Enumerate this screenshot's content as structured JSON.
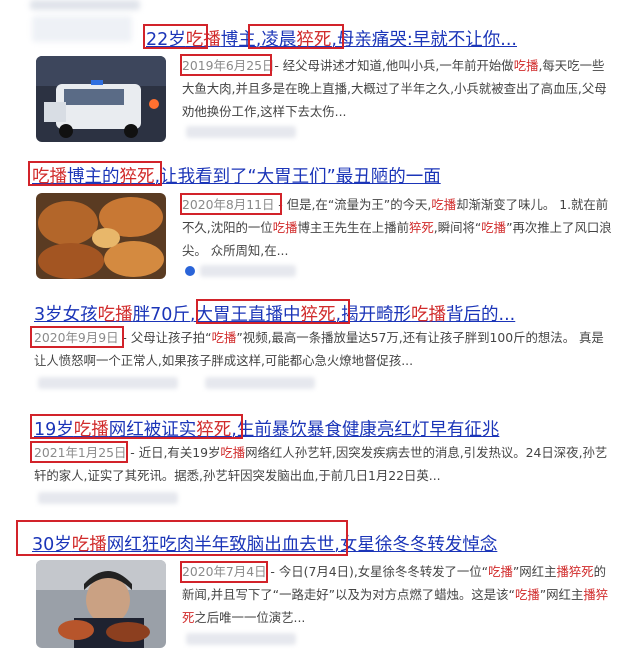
{
  "results": [
    {
      "title_parts": [
        {
          "t": "22岁",
          "hl": false
        },
        {
          "t": "吃播",
          "hl": true
        },
        {
          "t": "博主,凌晨",
          "hl": false
        },
        {
          "t": "猝死",
          "hl": true
        },
        {
          "t": ",母亲痛哭:早就不让你...",
          "hl": false
        }
      ],
      "date": "2019年6月25日",
      "snippet_parts": [
        {
          "t": "- 经父母讲述才知道,他叫小兵,一年前开始做",
          "hl": false
        },
        {
          "t": "吃播",
          "hl": true
        },
        {
          "t": ",每天吃一些大鱼大肉,并且多是在晚上直播,大概过了半年之久,小兵就被查出了高血压,父母劝他换份工作,这样下去太伤...",
          "hl": false
        }
      ]
    },
    {
      "title_parts": [
        {
          "t": "吃播",
          "hl": true
        },
        {
          "t": "博主的",
          "hl": false
        },
        {
          "t": "猝死",
          "hl": true
        },
        {
          "t": ",让我看到了“大胃王们”最丑陋的一面",
          "hl": false
        }
      ],
      "date": "2020年8月11日",
      "snippet_parts": [
        {
          "t": " - 但是,在“流量为王”的今天,",
          "hl": false
        },
        {
          "t": "吃播",
          "hl": true
        },
        {
          "t": "却渐渐变了味儿。 1.就在前不久,沈阳的一位",
          "hl": false
        },
        {
          "t": "吃播",
          "hl": true
        },
        {
          "t": "博主王先生在上播前",
          "hl": false
        },
        {
          "t": "猝死",
          "hl": true
        },
        {
          "t": ",瞬间将“",
          "hl": false
        },
        {
          "t": "吃播",
          "hl": true
        },
        {
          "t": "”再次推上了风口浪尖。 众所周知,在...",
          "hl": false
        }
      ]
    },
    {
      "title_parts": [
        {
          "t": "3岁女孩",
          "hl": false
        },
        {
          "t": "吃播",
          "hl": true
        },
        {
          "t": "胖70斤,",
          "hl": false
        },
        {
          "t": "大胃王直播中",
          "hl": false
        },
        {
          "t": "猝死",
          "hl": true
        },
        {
          "t": ",揭开畸形",
          "hl": false
        },
        {
          "t": "吃播",
          "hl": true
        },
        {
          "t": "背后的...",
          "hl": false
        }
      ],
      "date": "2020年9月9日",
      "snippet_parts": [
        {
          "t": " - 父母让孩子拍“",
          "hl": false
        },
        {
          "t": "吃播",
          "hl": true
        },
        {
          "t": "”视频,最高一条播放量达57万,还有让孩子胖到100斤的想法。 真是让人愤怒啊一个正常人,如果孩子胖成这样,可能都心急火燎地督促孩...",
          "hl": false
        }
      ]
    },
    {
      "title_parts": [
        {
          "t": "19岁",
          "hl": false
        },
        {
          "t": "吃播",
          "hl": true
        },
        {
          "t": "网红被证实",
          "hl": false
        },
        {
          "t": "猝死",
          "hl": true
        },
        {
          "t": ",生前暴饮暴食健康亮红灯早有征兆",
          "hl": false
        }
      ],
      "date": "2021年1月25日",
      "snippet_parts": [
        {
          "t": " - 近日,有关19岁",
          "hl": false
        },
        {
          "t": "吃播",
          "hl": true
        },
        {
          "t": "网络红人孙艺轩,因突发疾病去世的消息,引发热议。24日深夜,孙艺轩的家人,证实了其死讯。据悉,孙艺轩因突发脑出血,于前几日1月22日英...",
          "hl": false
        }
      ]
    },
    {
      "title_parts": [
        {
          "t": "30岁",
          "hl": false
        },
        {
          "t": "吃播",
          "hl": true
        },
        {
          "t": "网红狂吃肉半年致脑出血去世,女星徐冬冬转发悼念",
          "hl": false
        }
      ],
      "date": "2020年7月4日",
      "snippet_parts": [
        {
          "t": " - 今日(7月4日),女星徐冬冬转发了一位“",
          "hl": false
        },
        {
          "t": "吃播",
          "hl": true
        },
        {
          "t": "”网红主",
          "hl": false
        },
        {
          "t": "播猝死",
          "hl": true
        },
        {
          "t": "的新闻,并且写下了“一路走好”以及为对方点燃了蜡烛。这是该“",
          "hl": false
        },
        {
          "t": "吃播",
          "hl": true
        },
        {
          "t": "”网红主",
          "hl": false
        },
        {
          "t": "播猝死",
          "hl": true
        },
        {
          "t": "之后唯一一位演艺...",
          "hl": false
        }
      ]
    }
  ],
  "colors": {
    "title": "#1b35b8",
    "highlight": "#d12b2b",
    "annotation_box": "#d2232a"
  },
  "icons": [
    "source-icon"
  ]
}
